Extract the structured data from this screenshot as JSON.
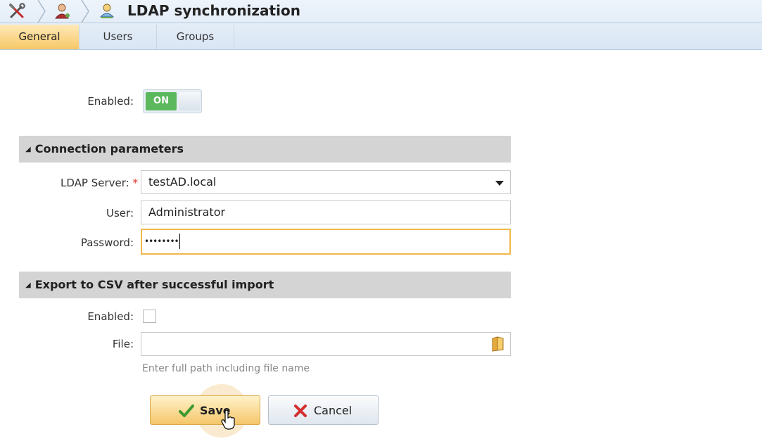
{
  "header": {
    "title": "LDAP synchronization",
    "icons": [
      "tools-icon",
      "user-settings-icon",
      "user-sync-icon"
    ]
  },
  "tabs": [
    {
      "label": "General",
      "active": true
    },
    {
      "label": "Users",
      "active": false
    },
    {
      "label": "Groups",
      "active": false
    }
  ],
  "general": {
    "enabled_label": "Enabled:",
    "toggle_text": "ON",
    "toggle_on": true
  },
  "connection": {
    "section_title": "Connection parameters",
    "server_label": "LDAP Server:",
    "required_mark": "*",
    "server_value": "testAD.local",
    "user_label": "User:",
    "user_value": "Administrator",
    "password_label": "Password:",
    "password_mask": "••••••••"
  },
  "export": {
    "section_title": "Export to CSV after successful import",
    "enabled_label": "Enabled:",
    "enabled_checked": false,
    "file_label": "File:",
    "file_value": "",
    "file_hint": "Enter full path including file name"
  },
  "actions": {
    "save_label": "Save",
    "cancel_label": "Cancel"
  },
  "colors": {
    "accent": "#f6c866",
    "toggle_on": "#5cb85c",
    "focus_border": "#f0b84a",
    "required": "#e0312b"
  }
}
